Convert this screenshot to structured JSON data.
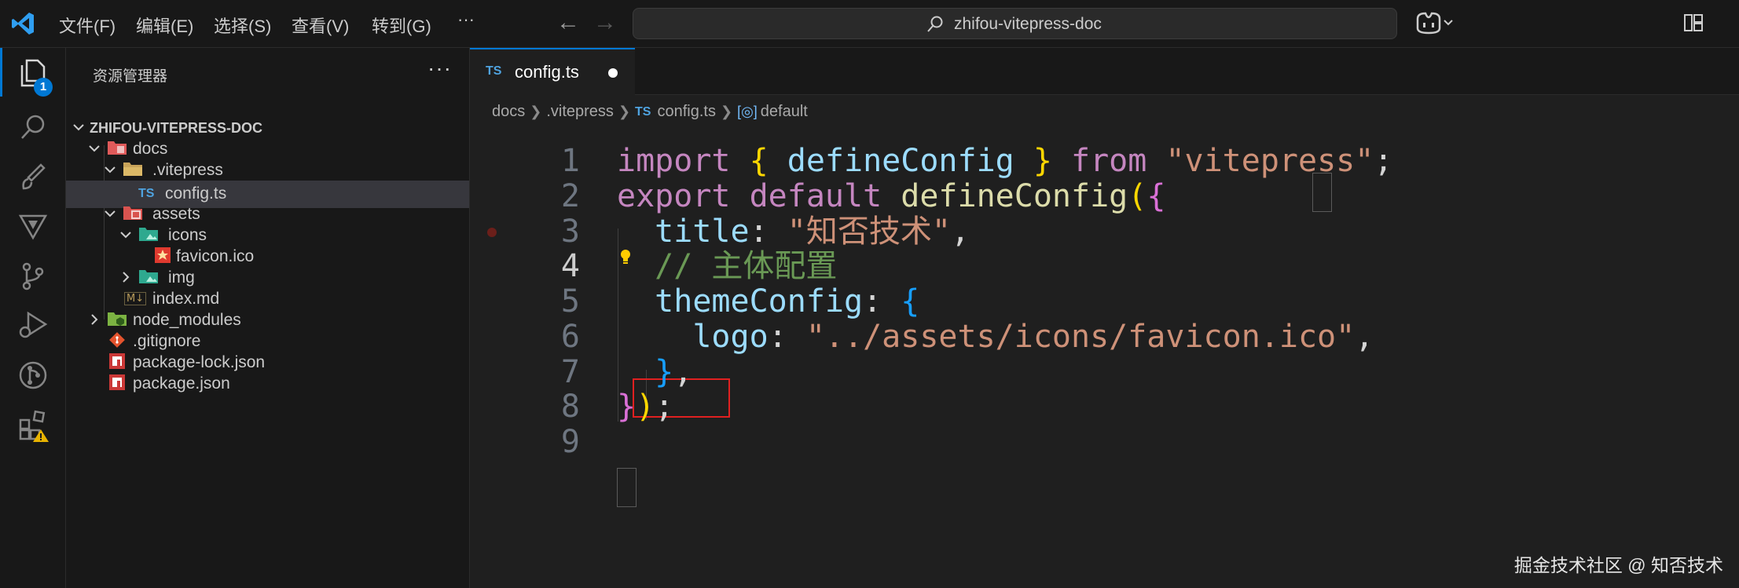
{
  "titlebar": {
    "menus": [
      "文件(F)",
      "编辑(E)",
      "选择(S)",
      "查看(V)",
      "转到(G)"
    ],
    "more": "···",
    "command_center": "zhifou-vitepress-doc"
  },
  "activity_bar": {
    "explorer_badge": "1"
  },
  "sidebar": {
    "title": "资源管理器",
    "more": "···",
    "tree": [
      {
        "label": "ZHIFOU-VITEPRESS-DOC",
        "icon": "chevron-down"
      },
      {
        "label": "docs",
        "icon": "folder-docs"
      },
      {
        "label": ".vitepress",
        "icon": "folder-vitepress"
      },
      {
        "label": "config.ts",
        "icon": "typescript-file",
        "badge": "TS"
      },
      {
        "label": "assets",
        "icon": "folder-assets"
      },
      {
        "label": "icons",
        "icon": "folder-images"
      },
      {
        "label": "favicon.ico",
        "icon": "favicon-file"
      },
      {
        "label": "img",
        "icon": "folder-images"
      },
      {
        "label": "index.md",
        "icon": "markdown-file",
        "badge": "M↓"
      },
      {
        "label": "node_modules",
        "icon": "folder-node"
      },
      {
        "label": ".gitignore",
        "icon": "git-file"
      },
      {
        "label": "package-lock.json",
        "icon": "npm-file"
      },
      {
        "label": "package.json",
        "icon": "npm-file"
      }
    ]
  },
  "editor": {
    "tab": {
      "badge": "TS",
      "label": "config.ts"
    },
    "breadcrumb": [
      "docs",
      ".vitepress",
      "config.ts",
      "default"
    ],
    "line_numbers": [
      "1",
      "2",
      "3",
      "4",
      "5",
      "6",
      "7",
      "8",
      "9"
    ],
    "current_line": "4",
    "code": {
      "l1": {
        "import": "import",
        "lb": "{",
        "name": " defineConfig ",
        "rb": "}",
        "from": " from ",
        "str": "\"vitepress\"",
        "semi": ";"
      },
      "l2": {
        "export": "export",
        "default": " default ",
        "fn": "defineConfig",
        "lp": "(",
        "lb": "{"
      },
      "l3": {
        "key": "title",
        "colon": ": ",
        "str": "\"知否技术\"",
        "comma": ","
      },
      "l4": {
        "comment": "// 主体配置"
      },
      "l5": {
        "key": "themeConfig",
        "colon": ": ",
        "lb": "{"
      },
      "l6": {
        "key": "logo",
        "colon": ":",
        "str": " \"../assets/icons/favicon.ico\"",
        "comma": ","
      },
      "l7": {
        "rb": "}",
        "comma": ","
      },
      "l8": {
        "rb": "}",
        "rp": ")",
        "semi": ";"
      }
    }
  },
  "watermark": "掘金技术社区 @ 知否技术",
  "colors": {
    "accent": "#0078d4",
    "highlight_box": "#e02020"
  }
}
